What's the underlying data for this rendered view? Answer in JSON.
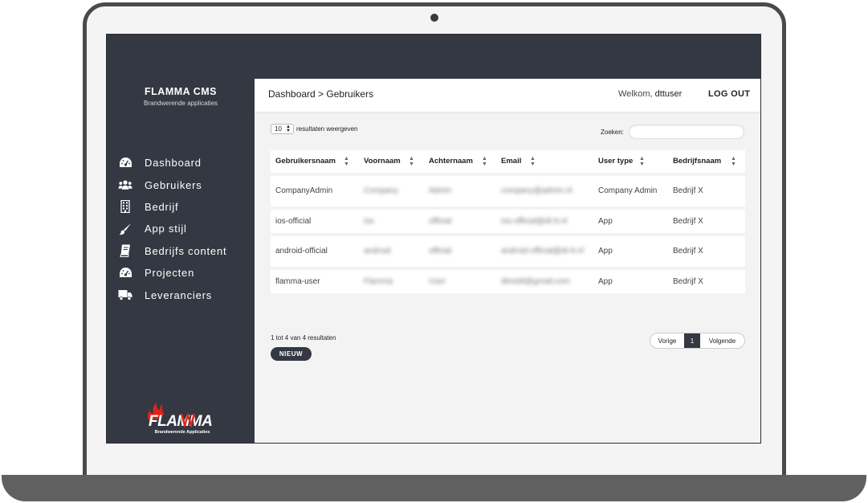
{
  "brand": {
    "title": "FLAMMA CMS",
    "subtitle": "Brandwerende applicaties",
    "logo_text": "FLAMMA",
    "logo_subtitle": "Brandwerende Applicaties"
  },
  "sidebar": {
    "items": [
      {
        "label": "Dashboard",
        "icon": "dashboard-icon"
      },
      {
        "label": "Gebruikers",
        "icon": "users-icon"
      },
      {
        "label": "Bedrijf",
        "icon": "building-icon"
      },
      {
        "label": "App stijl",
        "icon": "brush-icon"
      },
      {
        "label": "Bedrijfs content",
        "icon": "book-icon"
      },
      {
        "label": "Projecten",
        "icon": "dashboard-icon"
      },
      {
        "label": "Leveranciers",
        "icon": "truck-icon"
      }
    ]
  },
  "header": {
    "breadcrumb": "Dashboard > Gebruikers",
    "welcome_prefix": "Welkom,",
    "username": "dttuser",
    "logout_label": "LOG OUT"
  },
  "controls": {
    "page_length": "10",
    "page_length_label": "resultaten weergeven",
    "search_label": "Zoeken:",
    "search_value": ""
  },
  "table": {
    "columns": [
      "Gebruikersnaam",
      "Voornaam",
      "Achternaam",
      "Email",
      "User type",
      "Bedrijfsnaam"
    ],
    "rows": [
      [
        "CompanyAdmin",
        "Company",
        "Admin",
        "company@admin.nl",
        "Company Admin",
        "Bedrijf X"
      ],
      [
        "ios-official",
        "ios",
        "official",
        "ios-official@dt-tt.nl",
        "App",
        "Bedrijf X"
      ],
      [
        "android-official",
        "android",
        "official",
        "android-official@dt-tt.nl",
        "App",
        "Bedrijf X"
      ],
      [
        "flamma-user",
        "Flamma",
        "User",
        "dtestdt@gmail.com",
        "App",
        "Bedrijf X"
      ]
    ]
  },
  "footer": {
    "info": "1 tot 4 van 4 resultaten",
    "new_label": "NIEUW",
    "prev_label": "Vorige",
    "current_page": "1",
    "next_label": "Volgende"
  },
  "colors": {
    "sidebar_bg": "#343842",
    "content_bg": "#f3f3f3",
    "accent_red": "#e2231a"
  }
}
